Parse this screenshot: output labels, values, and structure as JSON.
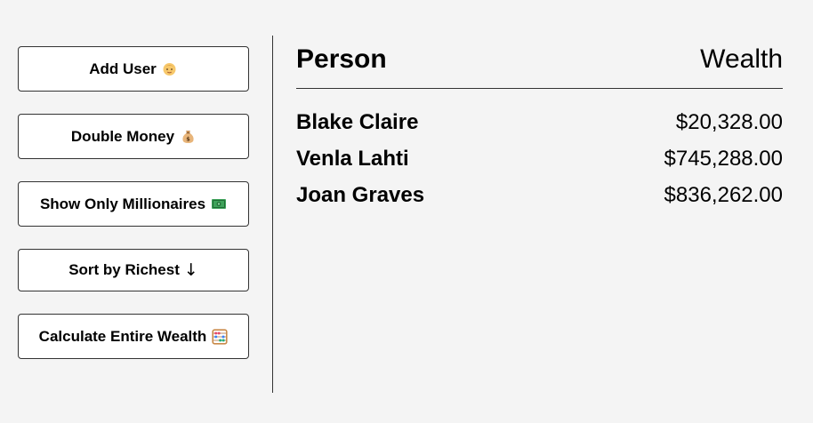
{
  "buttons": {
    "add_user": {
      "label": "Add User",
      "icon": "baby-face-icon"
    },
    "double_money": {
      "label": "Double Money",
      "icon": "money-bag-icon"
    },
    "show_millionaires": {
      "label": "Show Only Millionaires",
      "icon": "banknote-icon"
    },
    "sort_richest": {
      "label": "Sort by Richest",
      "arrow": "↓"
    },
    "calculate_wealth": {
      "label": "Calculate Entire Wealth",
      "icon": "abacus-icon"
    }
  },
  "table": {
    "header": {
      "person": "Person",
      "wealth": "Wealth"
    },
    "rows": [
      {
        "name": "Blake Claire",
        "wealth": "$20,328.00"
      },
      {
        "name": "Venla Lahti",
        "wealth": "$745,288.00"
      },
      {
        "name": "Joan Graves",
        "wealth": "$836,262.00"
      }
    ]
  },
  "colors": {
    "background": "#f4f4f4",
    "button_bg": "#ffffff",
    "border": "#333333",
    "text": "#000000"
  }
}
